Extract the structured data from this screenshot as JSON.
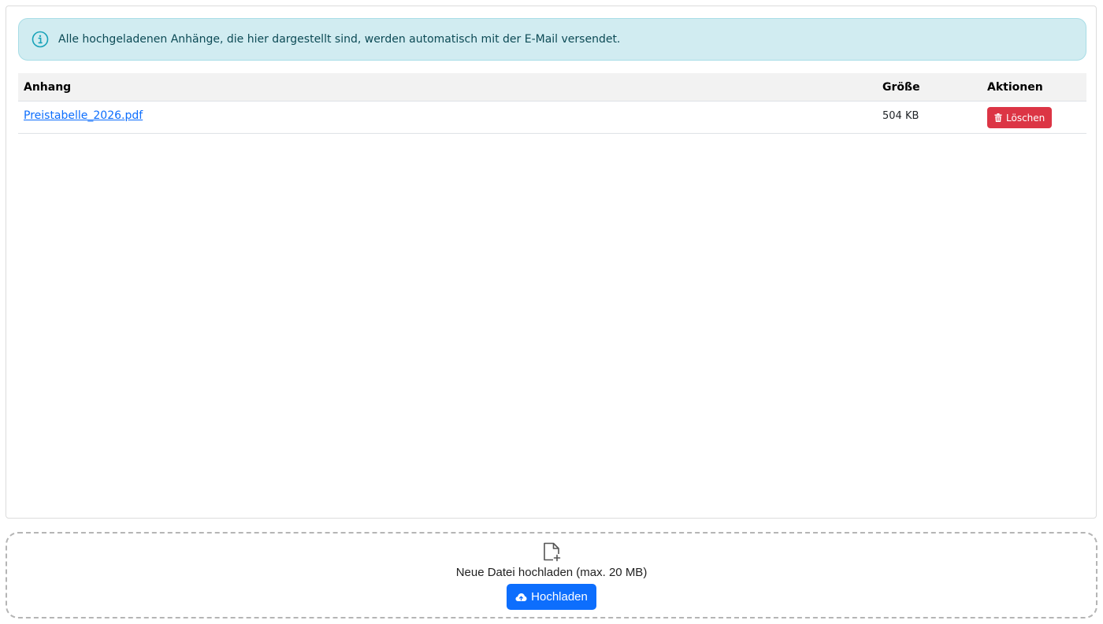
{
  "alert": {
    "icon": "info-circle-icon",
    "text": "Alle hochgeladenen Anhänge, die hier dargestellt sind, werden automatisch mit der E-Mail versendet."
  },
  "table": {
    "headers": [
      "Anhang",
      "Größe",
      "Aktionen"
    ],
    "rows": [
      {
        "name": "Preistabelle_2026.pdf",
        "size": "504 KB",
        "action_label": "Löschen",
        "action_icon": "trash-icon"
      }
    ]
  },
  "upload": {
    "icon": "file-plus-icon",
    "hint": "Neue Datei hochladen (max. 20 MB)",
    "button_label": "Hochladen",
    "button_icon": "cloud-upload-icon"
  },
  "colors": {
    "alert_bg": "#d1ecf1",
    "link": "#0d6efd",
    "danger": "#dc3545",
    "primary": "#0d6efd"
  }
}
